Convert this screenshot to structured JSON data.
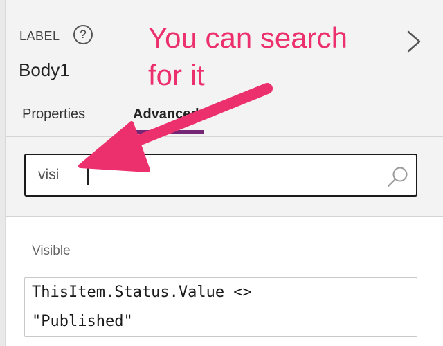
{
  "panel": {
    "control_type": "LABEL",
    "help_glyph": "?",
    "control_name": "Body1"
  },
  "tabs": [
    {
      "label": "Properties",
      "selected": false
    },
    {
      "label": "Advanced",
      "selected": true
    }
  ],
  "search": {
    "value": "visi",
    "icon": "search-icon"
  },
  "property": {
    "label": "Visible",
    "formula_line_1": "ThisItem.Status.Value <>",
    "formula_line_2": "\"Published\""
  },
  "annotation": {
    "line_1": "You can search",
    "line_2": "for it"
  },
  "colors": {
    "accent_tab": "#742774",
    "annotation": "#ec2f6d",
    "panel_bg": "#f3f3f3"
  }
}
